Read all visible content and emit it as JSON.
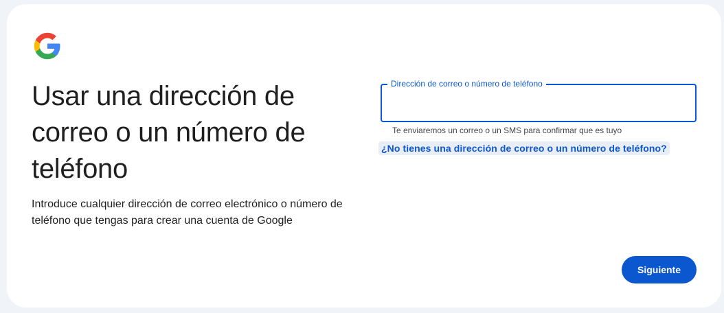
{
  "logo": {
    "icon": "google-g-icon",
    "colors": {
      "blue": "#4285f4",
      "green": "#34a853",
      "yellow": "#fbbc05",
      "red": "#ea4335"
    }
  },
  "heading": {
    "title": "Usar una dirección de correo o un número de teléfono",
    "subtitle": "Introduce cualquier dirección de correo electrónico o número de teléfono que tengas para crear una cuenta de Google"
  },
  "email_field": {
    "label": "Dirección de correo o número de teléfono",
    "value": "",
    "helper": "Te enviaremos un correo o un SMS para confirmar que es tuyo"
  },
  "alt_link": {
    "label": "¿No tienes una dirección de correo o un número de teléfono?"
  },
  "actions": {
    "next_label": "Siguiente"
  },
  "theme": {
    "accent": "#0b57d0",
    "background": "#f0f4f9",
    "card": "#ffffff",
    "text": "#1f1f1f"
  }
}
